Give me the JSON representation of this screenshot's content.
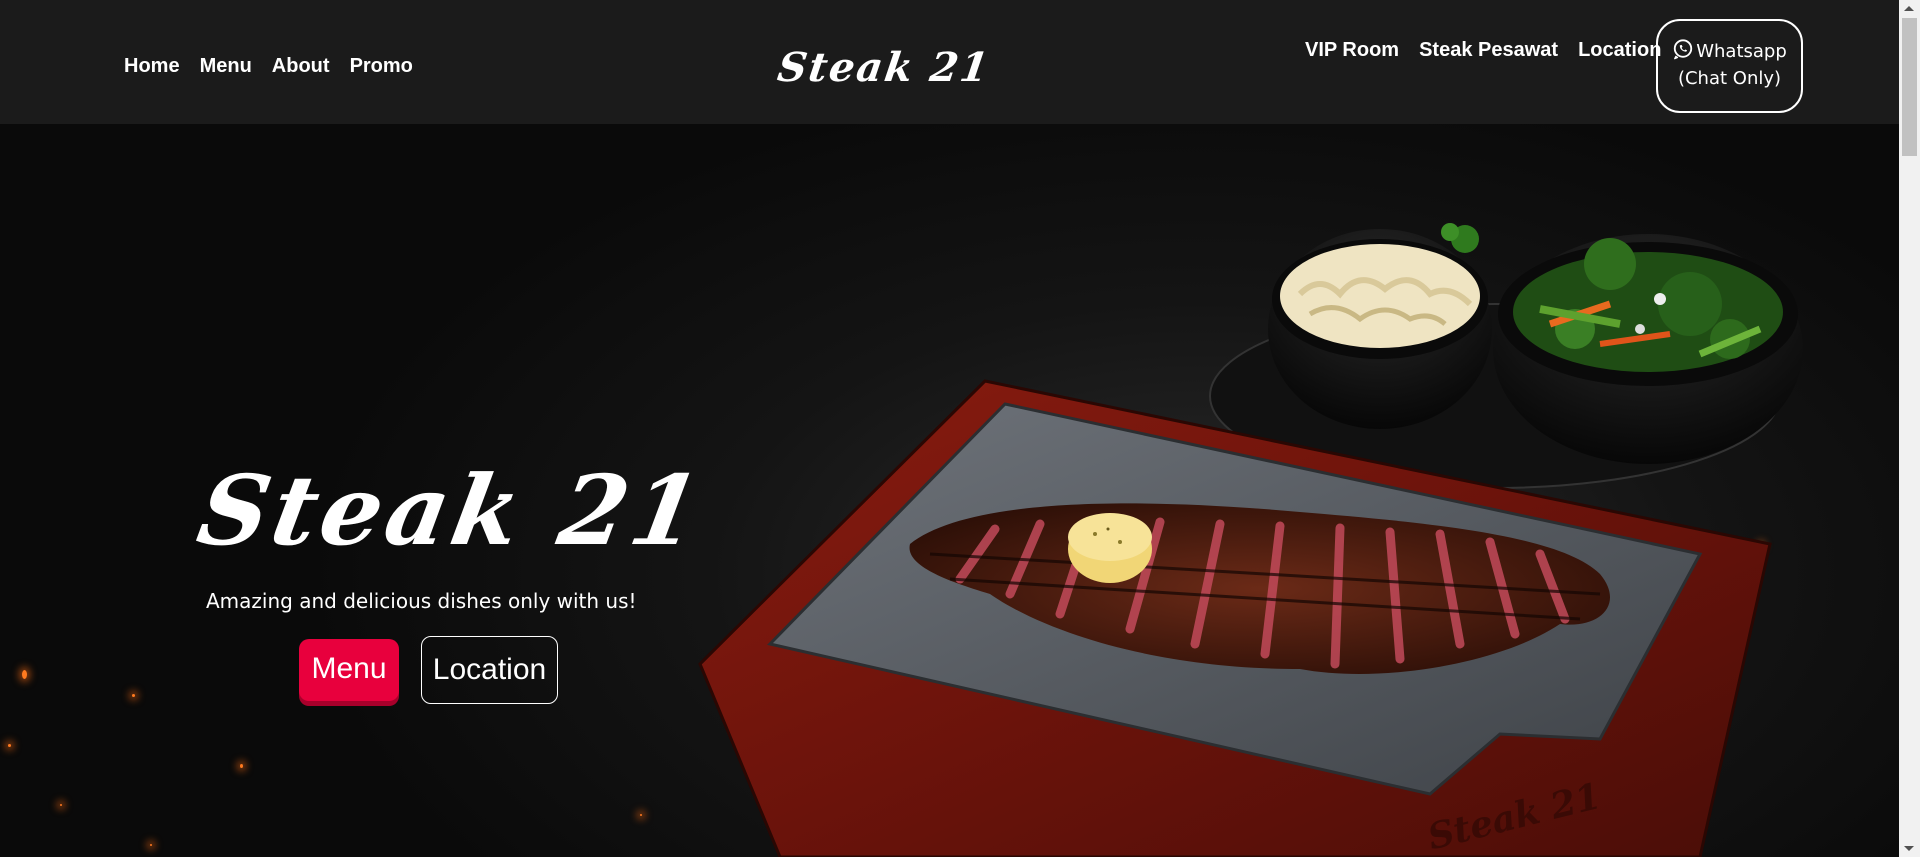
{
  "navbar": {
    "left_links": [
      "Home",
      "Menu",
      "About",
      "Promo"
    ],
    "brand": "Steak 21",
    "right_links": [
      "VIP Room",
      "Steak Pesawat",
      "Location"
    ],
    "whatsapp": {
      "line1": "Whatsapp",
      "line2": "(Chat Only)",
      "icon": "whatsapp-icon"
    }
  },
  "hero": {
    "title": "Steak 21",
    "subtitle": "Amazing and delicious dishes only with us!",
    "menu_button": "Menu",
    "location_button": "Location",
    "board_engraving": "Steak 21",
    "accent_color": "#e8003d"
  }
}
